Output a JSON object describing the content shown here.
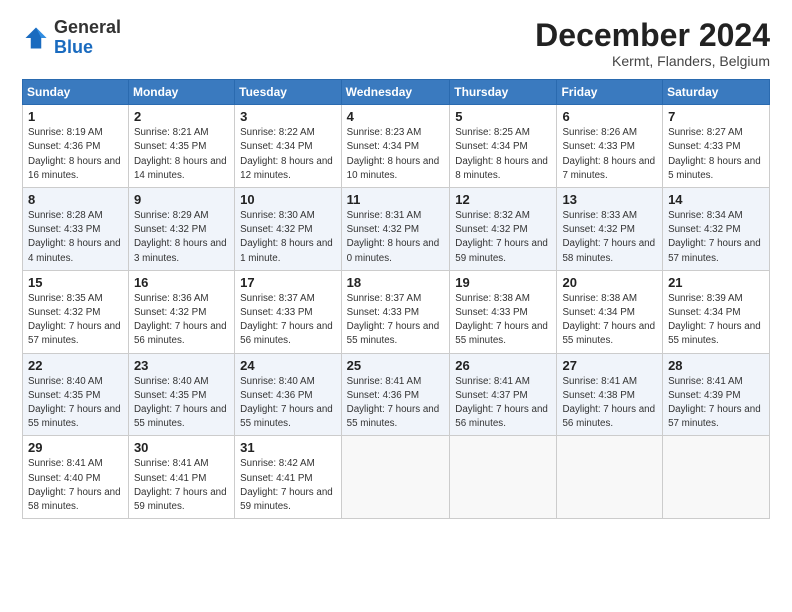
{
  "logo": {
    "general": "General",
    "blue": "Blue"
  },
  "title": {
    "month_year": "December 2024",
    "location": "Kermt, Flanders, Belgium"
  },
  "headers": [
    "Sunday",
    "Monday",
    "Tuesday",
    "Wednesday",
    "Thursday",
    "Friday",
    "Saturday"
  ],
  "weeks": [
    [
      {
        "day": "1",
        "sunrise": "8:19 AM",
        "sunset": "4:36 PM",
        "daylight": "8 hours and 16 minutes."
      },
      {
        "day": "2",
        "sunrise": "8:21 AM",
        "sunset": "4:35 PM",
        "daylight": "8 hours and 14 minutes."
      },
      {
        "day": "3",
        "sunrise": "8:22 AM",
        "sunset": "4:34 PM",
        "daylight": "8 hours and 12 minutes."
      },
      {
        "day": "4",
        "sunrise": "8:23 AM",
        "sunset": "4:34 PM",
        "daylight": "8 hours and 10 minutes."
      },
      {
        "day": "5",
        "sunrise": "8:25 AM",
        "sunset": "4:34 PM",
        "daylight": "8 hours and 8 minutes."
      },
      {
        "day": "6",
        "sunrise": "8:26 AM",
        "sunset": "4:33 PM",
        "daylight": "8 hours and 7 minutes."
      },
      {
        "day": "7",
        "sunrise": "8:27 AM",
        "sunset": "4:33 PM",
        "daylight": "8 hours and 5 minutes."
      }
    ],
    [
      {
        "day": "8",
        "sunrise": "8:28 AM",
        "sunset": "4:33 PM",
        "daylight": "8 hours and 4 minutes."
      },
      {
        "day": "9",
        "sunrise": "8:29 AM",
        "sunset": "4:32 PM",
        "daylight": "8 hours and 3 minutes."
      },
      {
        "day": "10",
        "sunrise": "8:30 AM",
        "sunset": "4:32 PM",
        "daylight": "8 hours and 1 minute."
      },
      {
        "day": "11",
        "sunrise": "8:31 AM",
        "sunset": "4:32 PM",
        "daylight": "8 hours and 0 minutes."
      },
      {
        "day": "12",
        "sunrise": "8:32 AM",
        "sunset": "4:32 PM",
        "daylight": "7 hours and 59 minutes."
      },
      {
        "day": "13",
        "sunrise": "8:33 AM",
        "sunset": "4:32 PM",
        "daylight": "7 hours and 58 minutes."
      },
      {
        "day": "14",
        "sunrise": "8:34 AM",
        "sunset": "4:32 PM",
        "daylight": "7 hours and 57 minutes."
      }
    ],
    [
      {
        "day": "15",
        "sunrise": "8:35 AM",
        "sunset": "4:32 PM",
        "daylight": "7 hours and 57 minutes."
      },
      {
        "day": "16",
        "sunrise": "8:36 AM",
        "sunset": "4:32 PM",
        "daylight": "7 hours and 56 minutes."
      },
      {
        "day": "17",
        "sunrise": "8:37 AM",
        "sunset": "4:33 PM",
        "daylight": "7 hours and 56 minutes."
      },
      {
        "day": "18",
        "sunrise": "8:37 AM",
        "sunset": "4:33 PM",
        "daylight": "7 hours and 55 minutes."
      },
      {
        "day": "19",
        "sunrise": "8:38 AM",
        "sunset": "4:33 PM",
        "daylight": "7 hours and 55 minutes."
      },
      {
        "day": "20",
        "sunrise": "8:38 AM",
        "sunset": "4:34 PM",
        "daylight": "7 hours and 55 minutes."
      },
      {
        "day": "21",
        "sunrise": "8:39 AM",
        "sunset": "4:34 PM",
        "daylight": "7 hours and 55 minutes."
      }
    ],
    [
      {
        "day": "22",
        "sunrise": "8:40 AM",
        "sunset": "4:35 PM",
        "daylight": "7 hours and 55 minutes."
      },
      {
        "day": "23",
        "sunrise": "8:40 AM",
        "sunset": "4:35 PM",
        "daylight": "7 hours and 55 minutes."
      },
      {
        "day": "24",
        "sunrise": "8:40 AM",
        "sunset": "4:36 PM",
        "daylight": "7 hours and 55 minutes."
      },
      {
        "day": "25",
        "sunrise": "8:41 AM",
        "sunset": "4:36 PM",
        "daylight": "7 hours and 55 minutes."
      },
      {
        "day": "26",
        "sunrise": "8:41 AM",
        "sunset": "4:37 PM",
        "daylight": "7 hours and 56 minutes."
      },
      {
        "day": "27",
        "sunrise": "8:41 AM",
        "sunset": "4:38 PM",
        "daylight": "7 hours and 56 minutes."
      },
      {
        "day": "28",
        "sunrise": "8:41 AM",
        "sunset": "4:39 PM",
        "daylight": "7 hours and 57 minutes."
      }
    ],
    [
      {
        "day": "29",
        "sunrise": "8:41 AM",
        "sunset": "4:40 PM",
        "daylight": "7 hours and 58 minutes."
      },
      {
        "day": "30",
        "sunrise": "8:41 AM",
        "sunset": "4:41 PM",
        "daylight": "7 hours and 59 minutes."
      },
      {
        "day": "31",
        "sunrise": "8:42 AM",
        "sunset": "4:41 PM",
        "daylight": "7 hours and 59 minutes."
      },
      null,
      null,
      null,
      null
    ]
  ]
}
